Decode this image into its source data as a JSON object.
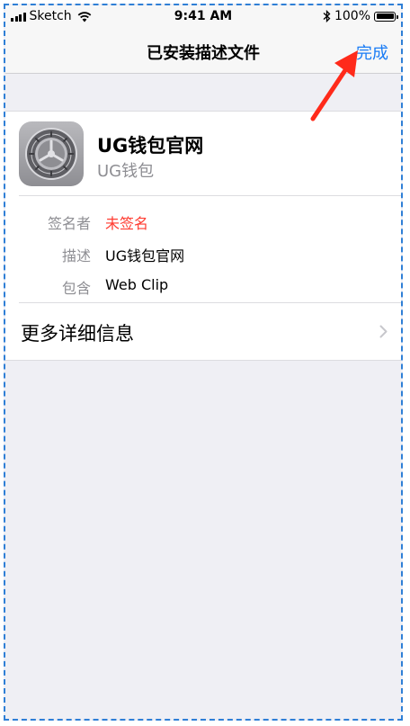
{
  "status_bar": {
    "carrier": "Sketch",
    "time": "9:41 AM",
    "battery": "100%",
    "icons": [
      "signal-icon",
      "wifi-icon",
      "bluetooth-icon",
      "battery-icon"
    ]
  },
  "nav": {
    "title": "已安装描述文件",
    "done_label": "完成"
  },
  "profile": {
    "icon": "settings-gear-icon",
    "name": "UG钱包官网",
    "subtitle": "UG钱包"
  },
  "details": [
    {
      "key": "签名者",
      "value": "未签名",
      "value_color": "#ff3b30"
    },
    {
      "key": "描述",
      "value": "UG钱包官网"
    },
    {
      "key": "包含",
      "value": "Web Clip"
    }
  ],
  "more_info": {
    "label": "更多详细信息",
    "icon": "chevron-right-icon"
  },
  "colors": {
    "accent": "#1a7cf5",
    "warning": "#ff3b30",
    "annotation_arrow": "#ff2a1a",
    "frame_border": "#2f7fd6",
    "background": "#efeff4"
  }
}
